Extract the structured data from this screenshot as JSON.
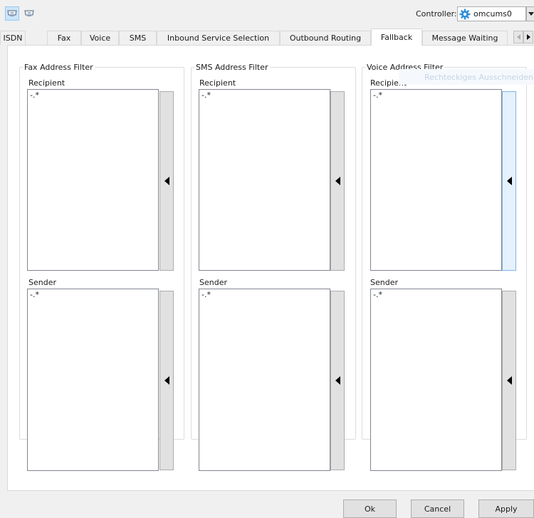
{
  "toolbar": {
    "controller_label": "Controller:",
    "controller_value": "omcums0",
    "controller_icon": "gear-icon"
  },
  "tabs": [
    {
      "label": "ISDN"
    },
    {
      "label": "Fax"
    },
    {
      "label": "Voice"
    },
    {
      "label": "SMS"
    },
    {
      "label": "Inbound Service Selection"
    },
    {
      "label": "Outbound Routing"
    },
    {
      "label": "Fallback",
      "selected": true
    },
    {
      "label": "Message Waiting"
    }
  ],
  "groups": [
    {
      "title": "Fax Address Filter",
      "recipient_label": "Recipient",
      "recipient_value": "-.*",
      "sender_label": "Sender",
      "sender_value": "-.*"
    },
    {
      "title": "SMS Address Filter",
      "recipient_label": "Recipient",
      "recipient_value": "-.*",
      "sender_label": "Sender",
      "sender_value": "-.*"
    },
    {
      "title": "Voice Address Filter",
      "recipient_label": "Recipient",
      "recipient_value": "-.*",
      "sender_label": "Sender",
      "sender_value": "-.*"
    }
  ],
  "overlay_text": "Rechteckiges Ausschneiden",
  "buttons": {
    "ok": "Ok",
    "cancel": "Cancel",
    "apply": "Apply"
  }
}
